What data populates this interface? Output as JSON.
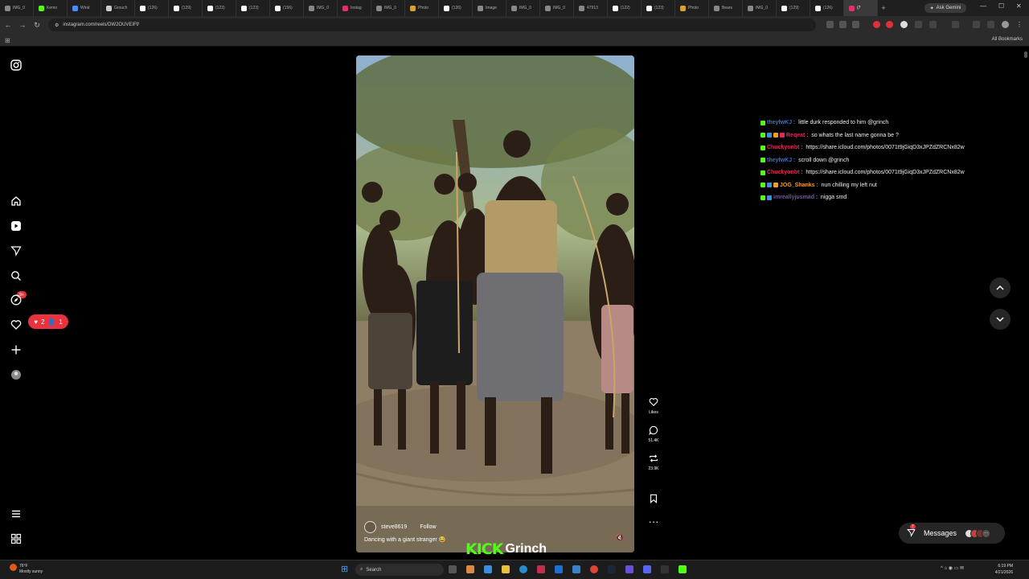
{
  "browser": {
    "tabs": [
      {
        "label": "IMG_0",
        "color": "#888888"
      },
      {
        "label": "Kemo",
        "color": "#53fc18"
      },
      {
        "label": "Wind",
        "color": "#4a8cff"
      },
      {
        "label": "Grouch",
        "color": "#cccccc"
      },
      {
        "label": "(126)",
        "color": "#ffffff"
      },
      {
        "label": "(129)",
        "color": "#ffffff"
      },
      {
        "label": "(123)",
        "color": "#ffffff"
      },
      {
        "label": "(123)",
        "color": "#ffffff"
      },
      {
        "label": "(156)",
        "color": "#ffffff"
      },
      {
        "label": "IMG_0",
        "color": "#888888"
      },
      {
        "label": "Instag",
        "color": "#e1306c"
      },
      {
        "label": "IMG_0",
        "color": "#888888"
      },
      {
        "label": "Photo",
        "color": "#d8a030"
      },
      {
        "label": "(126)",
        "color": "#ffffff"
      },
      {
        "label": "Image",
        "color": "#888888"
      },
      {
        "label": "IMG_0",
        "color": "#888888"
      },
      {
        "label": "IMG_0",
        "color": "#888888"
      },
      {
        "label": "47913",
        "color": "#888888"
      },
      {
        "label": "(122)",
        "color": "#ffffff"
      },
      {
        "label": "(123)",
        "color": "#ffffff"
      },
      {
        "label": "Photo",
        "color": "#d8a030"
      },
      {
        "label": "Bears",
        "color": "#888888"
      },
      {
        "label": "IMG_0",
        "color": "#888888"
      },
      {
        "label": "(129)",
        "color": "#ffffff"
      },
      {
        "label": "(126)",
        "color": "#ffffff"
      },
      {
        "label": "(7",
        "color": "#e1306c",
        "active": true
      }
    ],
    "new_tab": "+",
    "ask_gemini": "Ask Gemini",
    "url": "instagram.com/reels/DW2OUVEIFf/",
    "all_bookmarks": "All Bookmarks",
    "win_min": "—",
    "win_max": "☐",
    "win_close": "✕"
  },
  "nav": {
    "notif_badge": "9+",
    "likes_count": "2",
    "followers_count": "1"
  },
  "reel": {
    "author": "steve8619",
    "follow_label": "Follow",
    "caption": "Dancing with a giant stranger 😂",
    "actions": {
      "likes_label": "Likes",
      "comments_count": "51.4K",
      "reposts_count": "23.9K"
    }
  },
  "overlay": {
    "kick_logo": "KICK",
    "streamer": "Grinch"
  },
  "chat": [
    {
      "badges": 1,
      "user": "theyfwKJ",
      "user_color": "#3a6fd8",
      "text": "little durk responded to him @grinch"
    },
    {
      "badges": 4,
      "user": "Reqeat",
      "user_color": "#e0285a",
      "text": "so whats the last name gonna be ?"
    },
    {
      "badges": 1,
      "user": "Chuckyonbt",
      "user_color": "#e0285a",
      "text": "https://share.icloud.com/photos/0071t9jGiqD3xJPZdZRCNx82w"
    },
    {
      "badges": 1,
      "user": "theyfwKJ",
      "user_color": "#3a6fd8",
      "text": "scroll down @grinch"
    },
    {
      "badges": 1,
      "user": "Chuckyonbt",
      "user_color": "#e0285a",
      "text": "https://share.icloud.com/photos/0071t9jGiqD3xJPZdZRCNx82w"
    },
    {
      "badges": 3,
      "user": "JOG_Shanks",
      "user_color": "#f0a020",
      "text": "nun chilling my left nut"
    },
    {
      "badges": 2,
      "user": "imreallyjusmad",
      "user_color": "#7a4fb8",
      "text": "nigga smd"
    }
  ],
  "messages": {
    "label": "Messages",
    "badge": "7"
  },
  "taskbar": {
    "weather_temp": "76°F",
    "weather_desc": "Mostly sunny",
    "search_placeholder": "Search",
    "time": "6:19 PM",
    "date": "4/21/2026"
  }
}
